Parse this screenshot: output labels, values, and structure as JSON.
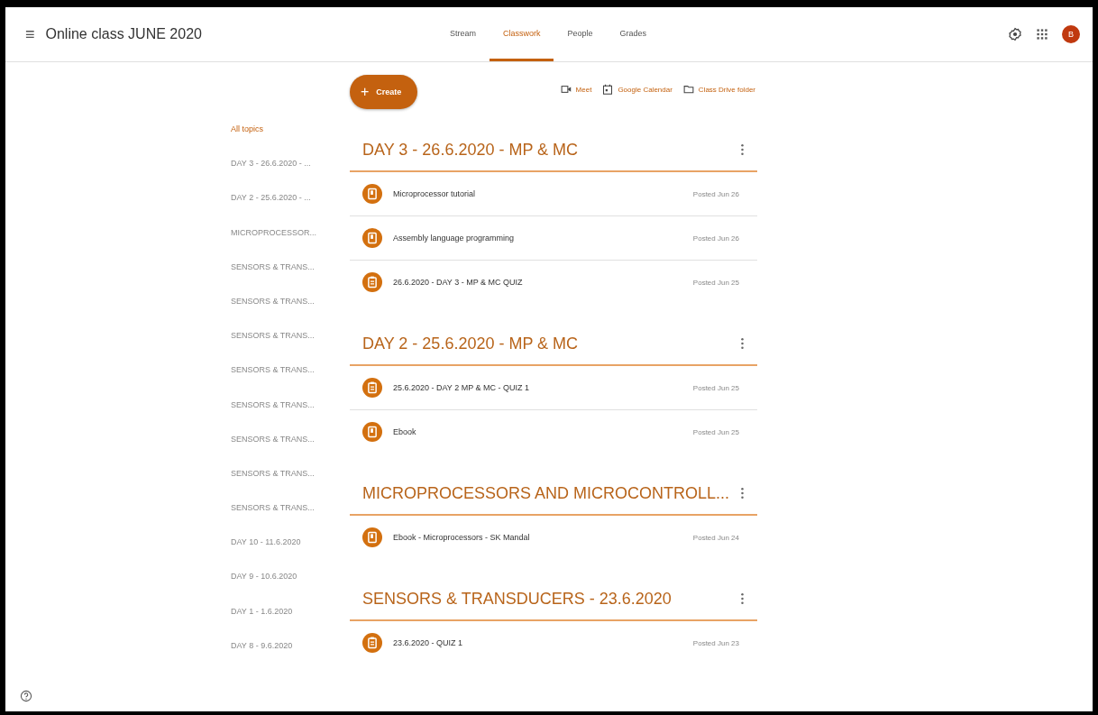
{
  "header": {
    "menu_glyph": "≡",
    "title": "Online class JUNE 2020",
    "avatar_letter": "B"
  },
  "tabs": [
    {
      "label": "Stream",
      "selected": false
    },
    {
      "label": "Classwork",
      "selected": true
    },
    {
      "label": "People",
      "selected": false
    },
    {
      "label": "Grades",
      "selected": false
    }
  ],
  "toolbar": {
    "create_label": "Create",
    "create_glyph": "+",
    "links": [
      {
        "kind": "video",
        "label": "Meet"
      },
      {
        "kind": "calendar",
        "label": "Google Calendar"
      },
      {
        "kind": "folder",
        "label": "Class Drive folder"
      }
    ]
  },
  "topics": [
    {
      "label": "All topics",
      "selected": true
    },
    {
      "label": "DAY 3 - 26.6.2020 - ...",
      "selected": false
    },
    {
      "label": "DAY 2 - 25.6.2020 - ...",
      "selected": false
    },
    {
      "label": "MICROPROCESSOR...",
      "selected": false
    },
    {
      "label": "SENSORS & TRANS...",
      "selected": false
    },
    {
      "label": "SENSORS & TRANS...",
      "selected": false
    },
    {
      "label": "SENSORS & TRANS...",
      "selected": false
    },
    {
      "label": "SENSORS & TRANS...",
      "selected": false
    },
    {
      "label": "SENSORS & TRANS...",
      "selected": false
    },
    {
      "label": "SENSORS & TRANS...",
      "selected": false
    },
    {
      "label": "SENSORS & TRANS...",
      "selected": false
    },
    {
      "label": "SENSORS & TRANS...",
      "selected": false
    },
    {
      "label": "DAY 10 - 11.6.2020",
      "selected": false
    },
    {
      "label": "DAY 9 - 10.6.2020",
      "selected": false
    },
    {
      "label": "DAY 1 - 1.6.2020",
      "selected": false
    },
    {
      "label": "DAY 8 - 9.6.2020",
      "selected": false
    }
  ],
  "sections": [
    {
      "title": "DAY 3 - 26.6.2020 - MP & MC",
      "items": [
        {
          "kind": "material",
          "title": "Microprocessor tutorial",
          "posted": "Posted Jun 26"
        },
        {
          "kind": "material",
          "title": "Assembly language programming",
          "posted": "Posted Jun 26"
        },
        {
          "kind": "quiz",
          "title": "26.6.2020 - DAY 3 - MP & MC QUIZ",
          "posted": "Posted Jun 25"
        }
      ]
    },
    {
      "title": "DAY 2 - 25.6.2020 - MP & MC",
      "items": [
        {
          "kind": "quiz",
          "title": "25.6.2020 - DAY 2 MP & MC - QUIZ 1",
          "posted": "Posted Jun 25"
        },
        {
          "kind": "material",
          "title": "Ebook",
          "posted": "Posted Jun 25"
        }
      ]
    },
    {
      "title": "MICROPROCESSORS AND MICROCONTROLL...",
      "items": [
        {
          "kind": "material",
          "title": "Ebook - Microprocessors - SK Mandal",
          "posted": "Posted Jun 24"
        }
      ]
    },
    {
      "title": "SENSORS & TRANSDUCERS - 23.6.2020",
      "items": [
        {
          "kind": "quiz",
          "title": "23.6.2020 - QUIZ 1",
          "posted": "Posted Jun 23"
        }
      ]
    }
  ]
}
